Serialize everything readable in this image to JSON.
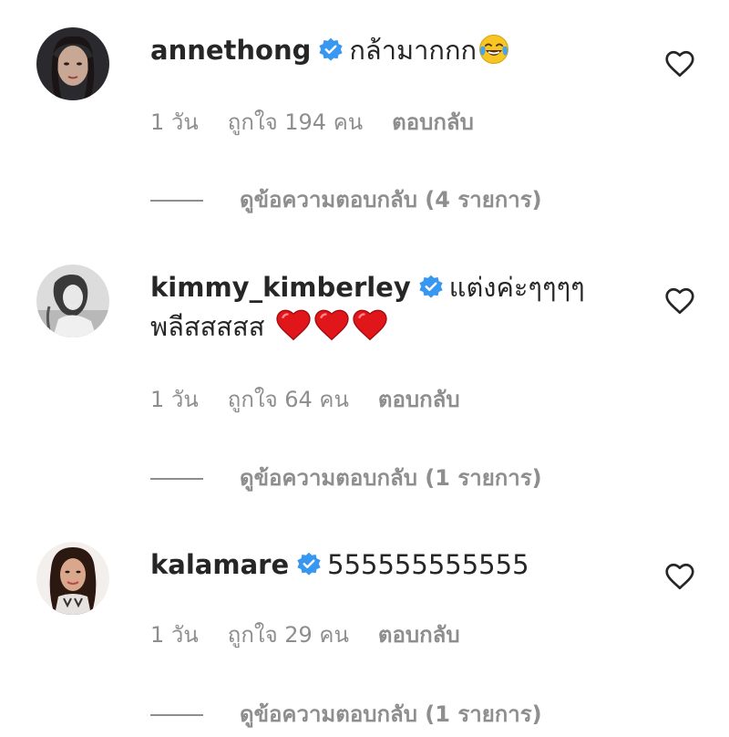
{
  "comments": [
    {
      "username": "annethong",
      "text": "กล้ามากกก",
      "emoji": "tears-of-joy-emoji",
      "time": "1 วัน",
      "likes": "ถูกใจ 194 คน",
      "reply": "ตอบกลับ",
      "view_replies": "ดูข้อความตอบกลับ (4 รายการ)"
    },
    {
      "username": "kimmy_kimberley",
      "text": "แต่งค่ะๆๆๆๆ",
      "text_line2": "พลีสสสสส",
      "emoji": "red-heart-emoji x3",
      "time": "1 วัน",
      "likes": "ถูกใจ 64 คน",
      "reply": "ตอบกลับ",
      "view_replies": "ดูข้อความตอบกลับ (1 รายการ)"
    },
    {
      "username": "kalamare",
      "text": "555555555555",
      "time": "1 วัน",
      "likes": "ถูกใจ 29 คน",
      "reply": "ตอบกลับ",
      "view_replies": "ดูข้อความตอบกลับ (1 รายการ)"
    }
  ],
  "colors": {
    "text": "#262626",
    "secondary": "#8e8e8e",
    "verified": "#3897f0",
    "heart_red": "#e0161b"
  }
}
